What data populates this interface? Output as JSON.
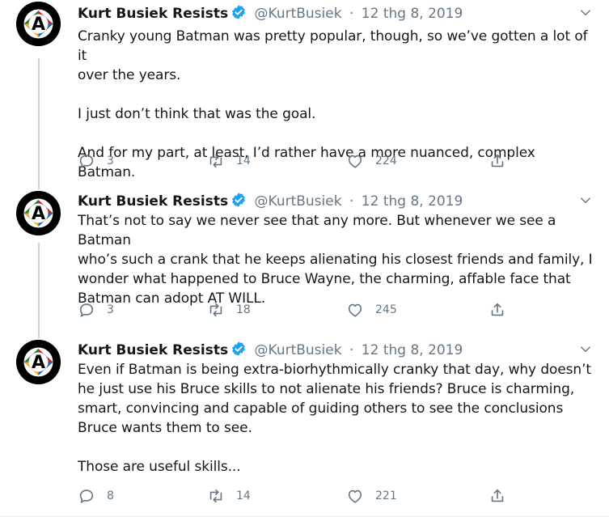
{
  "tweets": [
    {
      "name": "Kurt Busiek Resists",
      "handle": "@KurtBusiek",
      "date": "12 thg 8, 2019",
      "text": "Cranky young Batman was pretty popular, though, so we’ve gotten a lot of it\nover the years.\n\nI just don’t think that was the goal.\n\nAnd for my part, at least, I’d rather have a more nuanced, complex Batman.",
      "replies": "3",
      "retweets": "14",
      "likes": "224"
    },
    {
      "name": "Kurt Busiek Resists",
      "handle": "@KurtBusiek",
      "date": "12 thg 8, 2019",
      "text": "That’s not to say we never see that any more. But whenever we see a Batman\nwho’s such a crank that he keeps alienating his closest friends and family, I\nwonder what happened to Bruce Wayne, the charming, affable face that\nBatman can adopt AT WILL.",
      "replies": "3",
      "retweets": "18",
      "likes": "245"
    },
    {
      "name": "Kurt Busiek Resists",
      "handle": "@KurtBusiek",
      "date": "12 thg 8, 2019",
      "text": "Even if Batman is being extra-biorhythmically cranky that day, why doesn’t\nhe just use his Bruce skills to not alienate his friends? Bruce is charming,\nsmart, convincing and capable of guiding others to see the conclusions\nBruce wants them to see.\n\nThose are useful skills...",
      "replies": "8",
      "retweets": "14",
      "likes": "221"
    }
  ],
  "avatar_text": {
    "top": "ART AGAINST",
    "bottom": "BIGOTRY & FASCISM",
    "letter": "A"
  },
  "colors": {
    "text": "#14171a",
    "secondary": "#657786",
    "verified": "#1da1f2",
    "thread_line": "#ccd6dd"
  },
  "icons": [
    "reply-icon",
    "retweet-icon",
    "like-icon",
    "share-icon",
    "verified-badge-icon",
    "chevron-down-icon"
  ]
}
